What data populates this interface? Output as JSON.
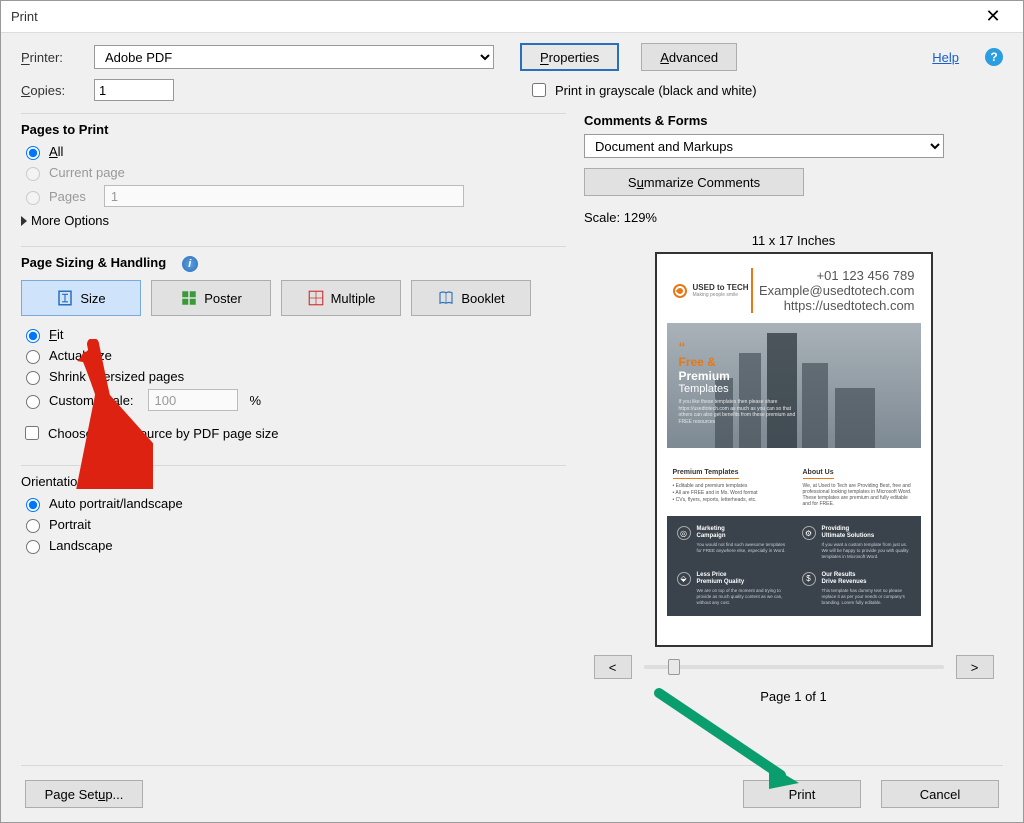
{
  "window_title": "Print",
  "toprow": {
    "printer_label": "Printer:",
    "printer_options": [
      "Adobe PDF"
    ],
    "printer_selected": "Adobe PDF",
    "properties_btn": "Properties",
    "advanced_btn": "Advanced",
    "help_link": "Help"
  },
  "row2": {
    "copies_label": "Copies:",
    "copies_value": "1",
    "grayscale_label": "Print in grayscale (black and white)"
  },
  "pages_to_print": {
    "title": "Pages to Print",
    "all": "All",
    "current": "Current page",
    "pages": "Pages",
    "pages_value": "1",
    "more": "More Options"
  },
  "sizing": {
    "title": "Page Sizing & Handling",
    "size": "Size",
    "poster": "Poster",
    "multiple": "Multiple",
    "booklet": "Booklet",
    "fit": "Fit",
    "actual": "Actual size",
    "shrink": "Shrink oversized pages",
    "custom": "Custom Scale:",
    "custom_value": "100",
    "percent": "%",
    "paper_source": "Choose paper source by PDF page size"
  },
  "orientation": {
    "title": "Orientation:",
    "auto": "Auto portrait/landscape",
    "portrait": "Portrait",
    "landscape": "Landscape"
  },
  "comments": {
    "title": "Comments & Forms",
    "selected": "Document and Markups",
    "summarize": "Summarize Comments"
  },
  "preview": {
    "scale": "Scale: 129%",
    "dimensions": "11 x 17 Inches",
    "prev": "<",
    "next": ">",
    "pageof": "Page 1 of 1",
    "doc": {
      "logo_name": "USED to TECH",
      "logo_sub": "Making people smile",
      "contact1": "+01 123 456 789",
      "contact2": "Example@usedtotech.com",
      "contact3": "https://usedtotech.com",
      "hero1": "Free &",
      "hero2": "Premium",
      "hero3": "Templates",
      "hero_small": "If you like these templates then please share https://usedtotech.com as much as you can so that others can also get benefits from these premium and FREE resources",
      "left_h": "Premium Templates",
      "left_1": "Editable and premium templates",
      "left_2": "All are FREE and in Ms. Word format",
      "left_3": "CVs, flyers, reports, letterheads, etc.",
      "right_h": "About Us",
      "right_body": "We, at Used to Tech are Providing Best, free and professional looking templates in Microsoft Word. These templates are premium and fully editable and for FREE.",
      "c1h1": "Marketing",
      "c1h2": "Campaign",
      "c1b": "You would not find such awesome templates for FREE anywhere else, especially in Word.",
      "c2h1": "Providing",
      "c2h2": "Ultimate Solutions",
      "c2b": "If you want a custom template from just us. We will be happy to provide you with quality templates in Microsoft Word.",
      "c3h1": "Less Price",
      "c3h2": "Premium Quality",
      "c3b": "We are on top of the moment and trying to provide as much quality content as we can, without any cost.",
      "c4h1": "Our Results",
      "c4h2": "Drive Revenues",
      "c4b": "This template has dummy text so please replace it as per your needs or company's branding. Lorem fully editable."
    }
  },
  "footer": {
    "page_setup": "Page Setup...",
    "print": "Print",
    "cancel": "Cancel"
  }
}
